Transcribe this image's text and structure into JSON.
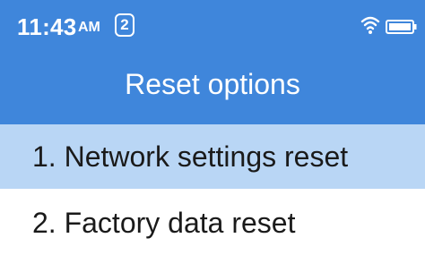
{
  "status_bar": {
    "time": "11:43",
    "ampm": "AM",
    "notification_count": "2",
    "icons": [
      "wifi-icon",
      "battery-icon"
    ]
  },
  "header": {
    "title": "Reset options"
  },
  "menu": {
    "items": [
      {
        "label": "1. Network settings reset",
        "selected": true
      },
      {
        "label": "2. Factory data reset",
        "selected": false
      }
    ]
  },
  "colors": {
    "header_background": "#3f86db",
    "selected_background": "#b9d6f5",
    "text": "#1a1a1a"
  }
}
